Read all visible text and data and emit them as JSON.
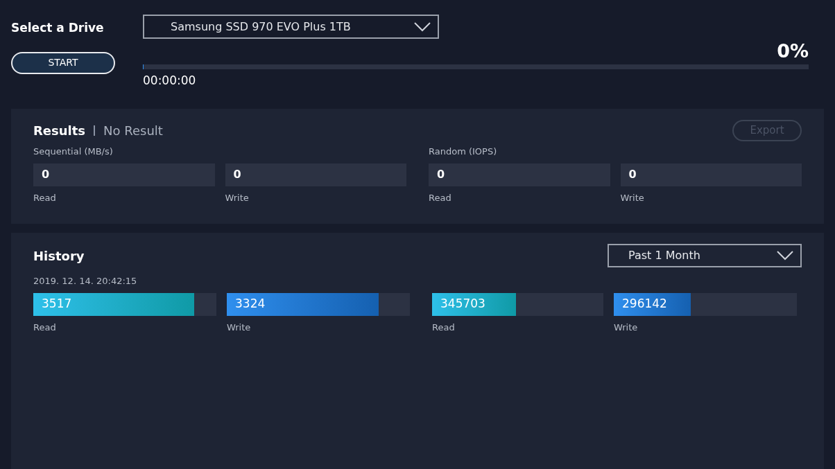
{
  "drive": {
    "label": "Select a Drive",
    "value": "Samsung SSD 970 EVO Plus 1TB"
  },
  "start_button": "START",
  "progress": {
    "percent": "0%",
    "level": 0,
    "elapsed": "00:00:00"
  },
  "results": {
    "title": "Results",
    "status": "No Result",
    "export": {
      "label": "Export",
      "disabled": true
    },
    "groups": [
      {
        "title": "Sequential (MB/s)",
        "fields": [
          {
            "value": "0",
            "label": "Read"
          },
          {
            "value": "0",
            "label": "Write"
          }
        ]
      },
      {
        "title": "Random (IOPS)",
        "fields": [
          {
            "value": "0",
            "label": "Read"
          },
          {
            "value": "0",
            "label": "Write"
          }
        ]
      }
    ]
  },
  "history": {
    "title": "History",
    "period": "Past 1 Month",
    "timestamp": "2019. 12. 14. 20:42:15",
    "bars": [
      {
        "kind": "read",
        "value": "3517",
        "label": "Read",
        "level": 0.88
      },
      {
        "kind": "write",
        "value": "3324",
        "label": "Write",
        "level": 0.83
      },
      {
        "kind": "read",
        "value": "345703",
        "label": "Read",
        "level": 0.49
      },
      {
        "kind": "write",
        "value": "296142",
        "label": "Write",
        "level": 0.42
      }
    ]
  }
}
